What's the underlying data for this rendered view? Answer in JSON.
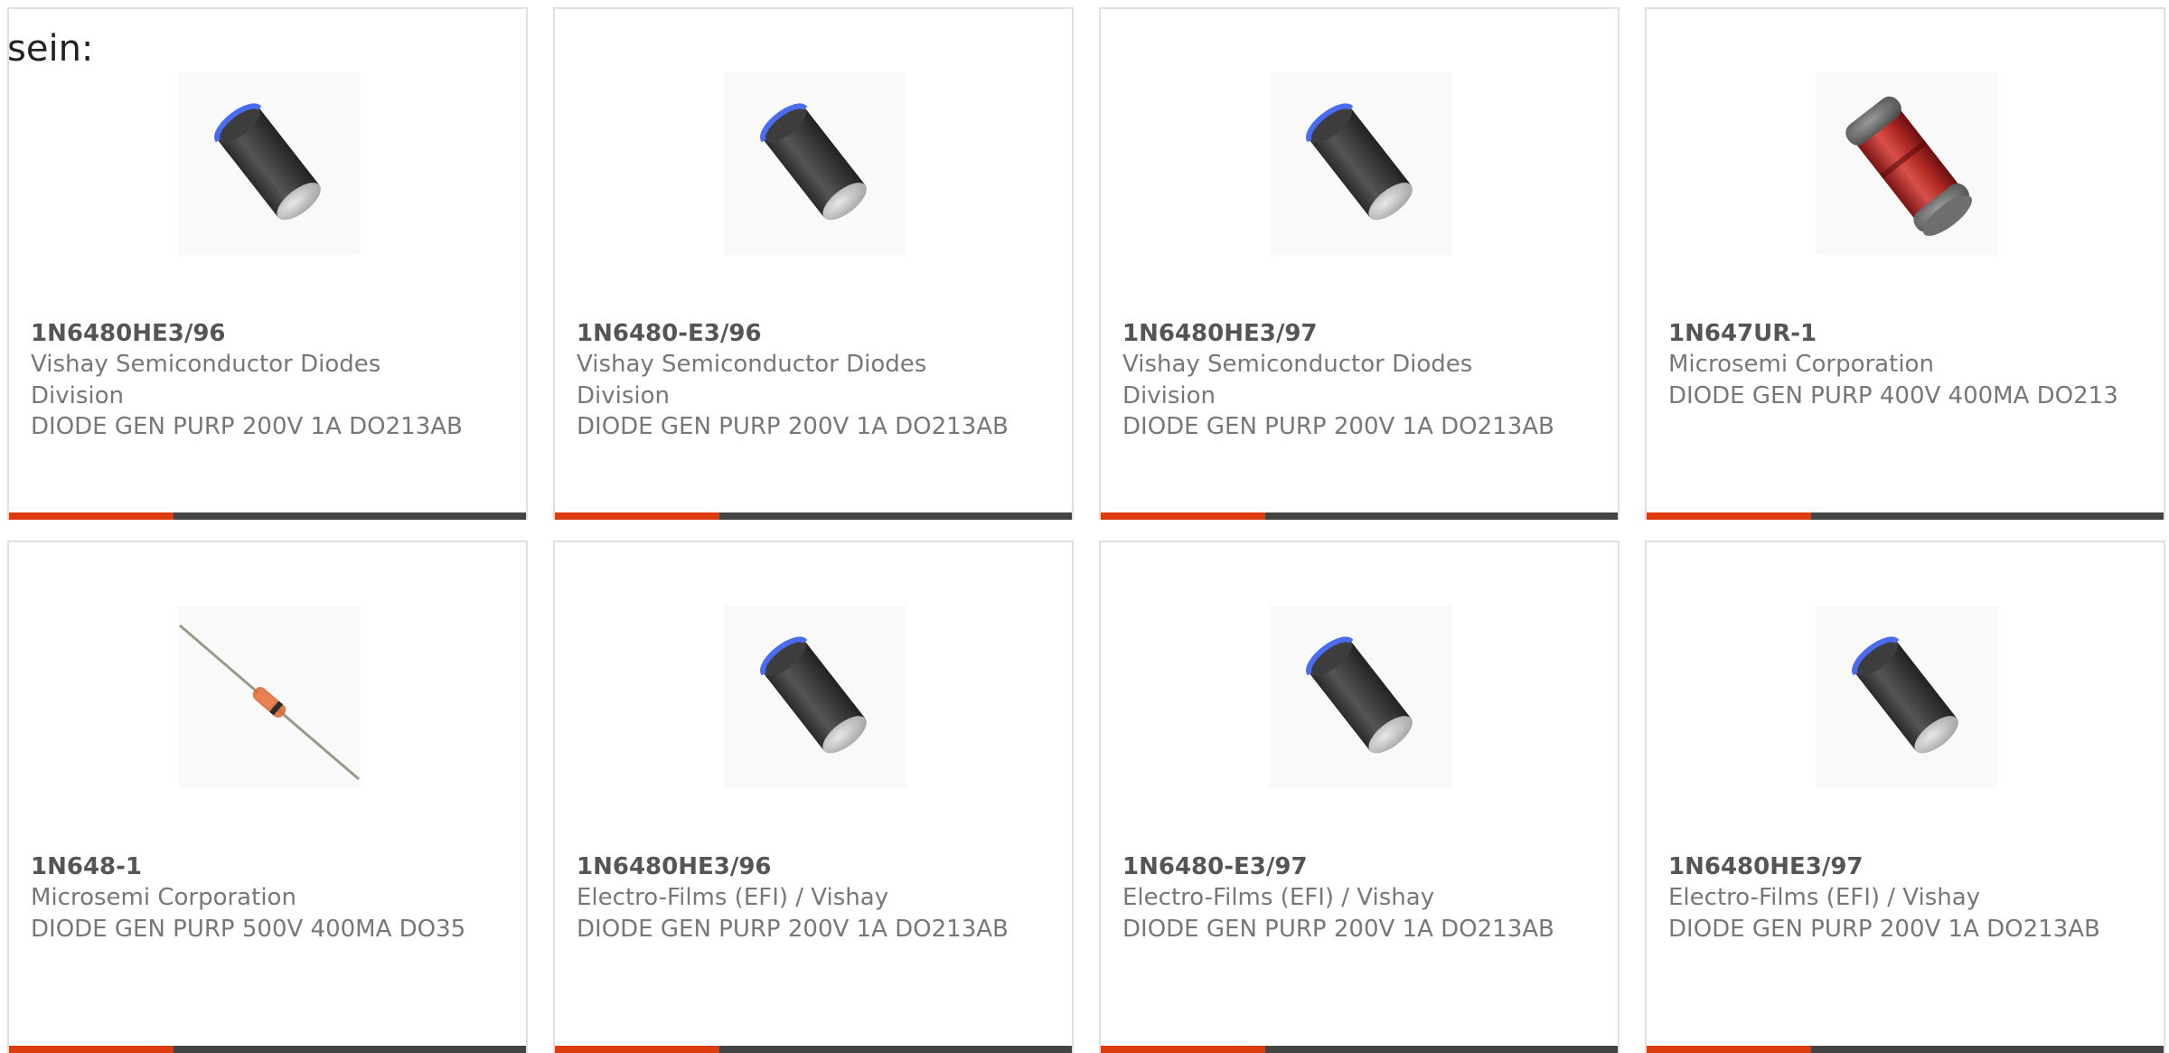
{
  "intro_text": "sein:",
  "colors": {
    "accent": "#dd3c10",
    "bar": "#444444",
    "text": "#777777",
    "part_number": "#555555",
    "border": "#e0e0e0"
  },
  "products": [
    {
      "part_number": "1N6480HE3/96",
      "manufacturer": "Vishay Semiconductor Diodes Division",
      "description": "DIODE GEN PURP 200V 1A DO213AB",
      "image": "melf-diode-black"
    },
    {
      "part_number": "1N6480-E3/96",
      "manufacturer": "Vishay Semiconductor Diodes Division",
      "description": "DIODE GEN PURP 200V 1A DO213AB",
      "image": "melf-diode-black"
    },
    {
      "part_number": "1N6480HE3/97",
      "manufacturer": "Vishay Semiconductor Diodes Division",
      "description": "DIODE GEN PURP 200V 1A DO213AB",
      "image": "melf-diode-black"
    },
    {
      "part_number": "1N647UR-1",
      "manufacturer": "Microsemi Corporation",
      "description": "DIODE GEN PURP 400V 400MA DO213",
      "image": "melf-diode-red-glass"
    },
    {
      "part_number": "1N648-1",
      "manufacturer": "Microsemi Corporation",
      "description": "DIODE GEN PURP 500V 400MA DO35",
      "image": "axial-diode-glass"
    },
    {
      "part_number": "1N6480HE3/96",
      "manufacturer": "Electro-Films (EFI) / Vishay",
      "description": "DIODE GEN PURP 200V 1A DO213AB",
      "image": "melf-diode-black"
    },
    {
      "part_number": "1N6480-E3/97",
      "manufacturer": "Electro-Films (EFI) / Vishay",
      "description": "DIODE GEN PURP 200V 1A DO213AB",
      "image": "melf-diode-black"
    },
    {
      "part_number": "1N6480HE3/97",
      "manufacturer": "Electro-Films (EFI) / Vishay",
      "description": "DIODE GEN PURP 200V 1A DO213AB",
      "image": "melf-diode-black"
    }
  ]
}
